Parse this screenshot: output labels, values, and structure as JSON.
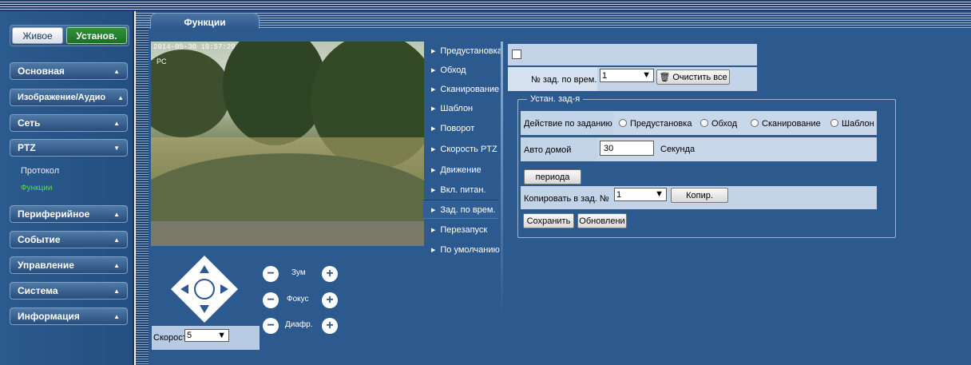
{
  "sidebar": {
    "live_label": "Живое",
    "setup_label": "Установ.",
    "menu": [
      {
        "label": "Основная",
        "arrow": "▲"
      },
      {
        "label": "Изображение/Аудио",
        "arrow": "▲"
      },
      {
        "label": "Сеть",
        "arrow": "▲"
      },
      {
        "label": "PTZ",
        "arrow": "▼"
      },
      {
        "label": "Периферийное",
        "arrow": "▲"
      },
      {
        "label": "Событие",
        "arrow": "▲"
      },
      {
        "label": "Управление",
        "arrow": "▲"
      },
      {
        "label": "Система",
        "arrow": "▲"
      },
      {
        "label": "Информация",
        "arrow": "▲"
      }
    ],
    "ptz_sub": [
      "Протокол",
      "Функции"
    ]
  },
  "tab": {
    "label": "Функции"
  },
  "video": {
    "timestamp": "2014-05-30 19:57:29",
    "camera_name": "PC"
  },
  "ptz": {
    "zoom_label": "Зум",
    "focus_label": "Фокус",
    "iris_label": "Диафр.",
    "minus": "−",
    "plus": "+",
    "speed_label": "Скорост",
    "speed_value": "5"
  },
  "functions": [
    "Предустановка",
    "Обход",
    "Сканирование",
    "Шаблон",
    "Поворот",
    "Скорость PTZ",
    "Движение",
    "Вкл. питан.",
    "Зад. по врем.",
    "Перезапуск",
    "По умолчанию"
  ],
  "form": {
    "enable_checked": false,
    "task_no_label": "№ зад. по врем.",
    "task_no_value": "1",
    "clear_all_label": "Очистить все",
    "group_title": "Устан. зад-я",
    "action_label": "Действие по заданию",
    "action_options": [
      "Предустановка",
      "Обход",
      "Сканирование",
      "Шаблон"
    ],
    "auto_home_label": "Авто домой",
    "auto_home_value": "30",
    "seconds_label": "Секунда",
    "period_button": "периода",
    "copy_to_label": "Копировать в зад. №",
    "copy_to_value": "1",
    "copy_button": "Копир.",
    "save_button": "Сохранить",
    "refresh_button": "Обновлени"
  },
  "colors": {
    "background": "#2c5a8f",
    "sidebar": "#285486",
    "active_green": "#4fe04a",
    "setup_button": "#25812e",
    "light_panel": "#c3d3e8"
  }
}
